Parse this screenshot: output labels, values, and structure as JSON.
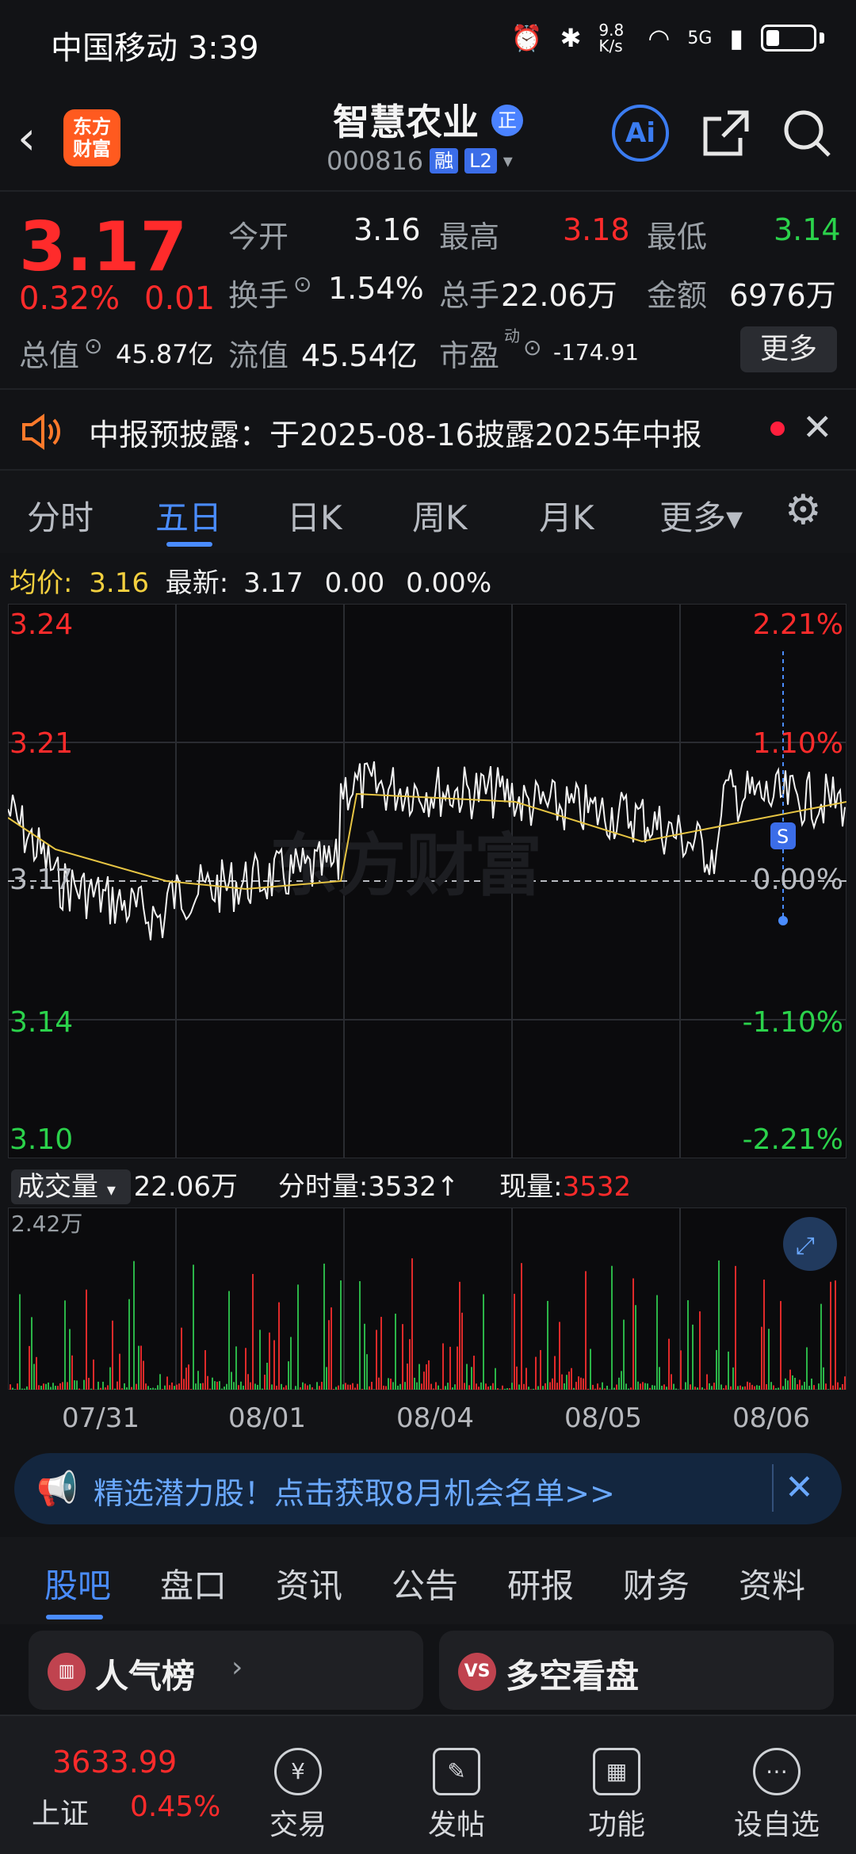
{
  "status_bar": {
    "carrier_time": "中国移动 3:39",
    "net_speed": "9.8 K/s",
    "signal": "5G"
  },
  "header": {
    "name": "智慧农业",
    "badge": "正",
    "code": "000816",
    "tag1": "融",
    "tag2": "L2",
    "logo_line1": "东方",
    "logo_line2": "财富",
    "ai_label": "Ai"
  },
  "quote": {
    "price": "3.17",
    "pct": "0.32%",
    "change": "0.01",
    "open_label": "今开",
    "open": "3.16",
    "high_label": "最高",
    "high": "3.18",
    "low_label": "最低",
    "low": "3.14",
    "turnover_label": "换手",
    "turnover": "1.54%",
    "vol_label": "总手",
    "vol": "22.06万",
    "amount_label": "金额",
    "amount": "6976万",
    "mcap_label": "总值",
    "mcap": "45.87亿",
    "float_label": "流值",
    "float": "45.54亿",
    "pe_label": "市盈",
    "pe_sup": "动",
    "pe": "-174.91",
    "more_label": "更多"
  },
  "notice": {
    "text": "中报预披露：于2025-08-16披露2025年中报"
  },
  "tabs": [
    "分时",
    "五日",
    "日K",
    "周K",
    "月K",
    "更多▾"
  ],
  "info_line": {
    "avg_label": "均价:",
    "avg": "3.16",
    "latest_label": "最新:",
    "latest": "3.17",
    "chg": "0.00",
    "pct": "0.00%"
  },
  "chart": {
    "left_labels": [
      "3.24",
      "3.21",
      "3.17",
      "3.14",
      "3.10"
    ],
    "right_labels": [
      "2.21%",
      "1.10%",
      "0.00%",
      "-1.10%",
      "-2.21%"
    ],
    "watermark": "东方财富",
    "marker": "S"
  },
  "volume": {
    "select_label": "成交量",
    "total": "22.06万",
    "minute_label": "分时量:3532↑",
    "now_label": "现量:",
    "now": "3532",
    "max": "2.42万"
  },
  "dates": [
    "07/31",
    "08/01",
    "08/04",
    "08/05",
    "08/06"
  ],
  "banner": {
    "text": "精选潜力股！点击获取8月机会名单>>"
  },
  "section_tabs": [
    "股吧",
    "盘口",
    "资讯",
    "公告",
    "研报",
    "财务",
    "资料"
  ],
  "cards": {
    "left": "人气榜",
    "right": "多空看盘"
  },
  "bottom_bar": {
    "index_value": "3633.99",
    "index_name": "上证",
    "index_pct": "0.45%",
    "items": [
      "交易",
      "发帖",
      "功能",
      "设自选"
    ]
  },
  "colors": {
    "up": "#ff2b2b",
    "down": "#2bd24b",
    "accent": "#4a8cff"
  }
}
